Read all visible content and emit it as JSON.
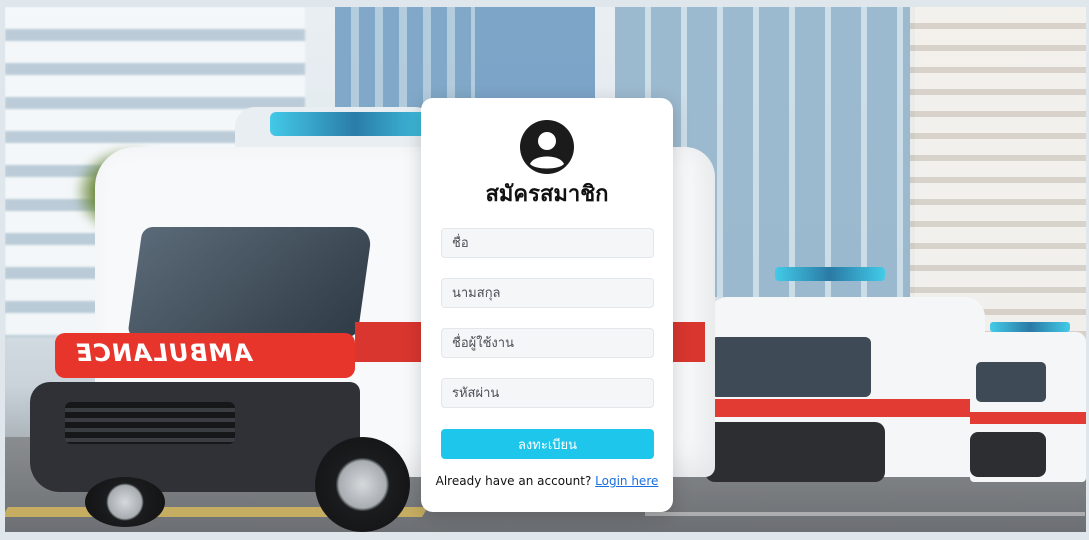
{
  "form": {
    "title": "สมัครสมาชิก",
    "fields": [
      {
        "placeholder": "ชื่อ",
        "value": ""
      },
      {
        "placeholder": "นามสกุล",
        "value": ""
      },
      {
        "placeholder": "ชื่อผู้ใช้งาน",
        "value": ""
      },
      {
        "placeholder": "รหัสผ่าน",
        "value": ""
      }
    ],
    "submit_label": "ลงทะเบียน",
    "footer_text": "Already have an account? ",
    "login_link": "Login here",
    "avatar_icon": "user-circle-icon"
  },
  "background": {
    "vehicle_text": "AMBULANCE"
  },
  "colors": {
    "accent": "#1fc6ec",
    "link": "#1a6fe0",
    "card": "#ffffff",
    "text": "#111111"
  }
}
